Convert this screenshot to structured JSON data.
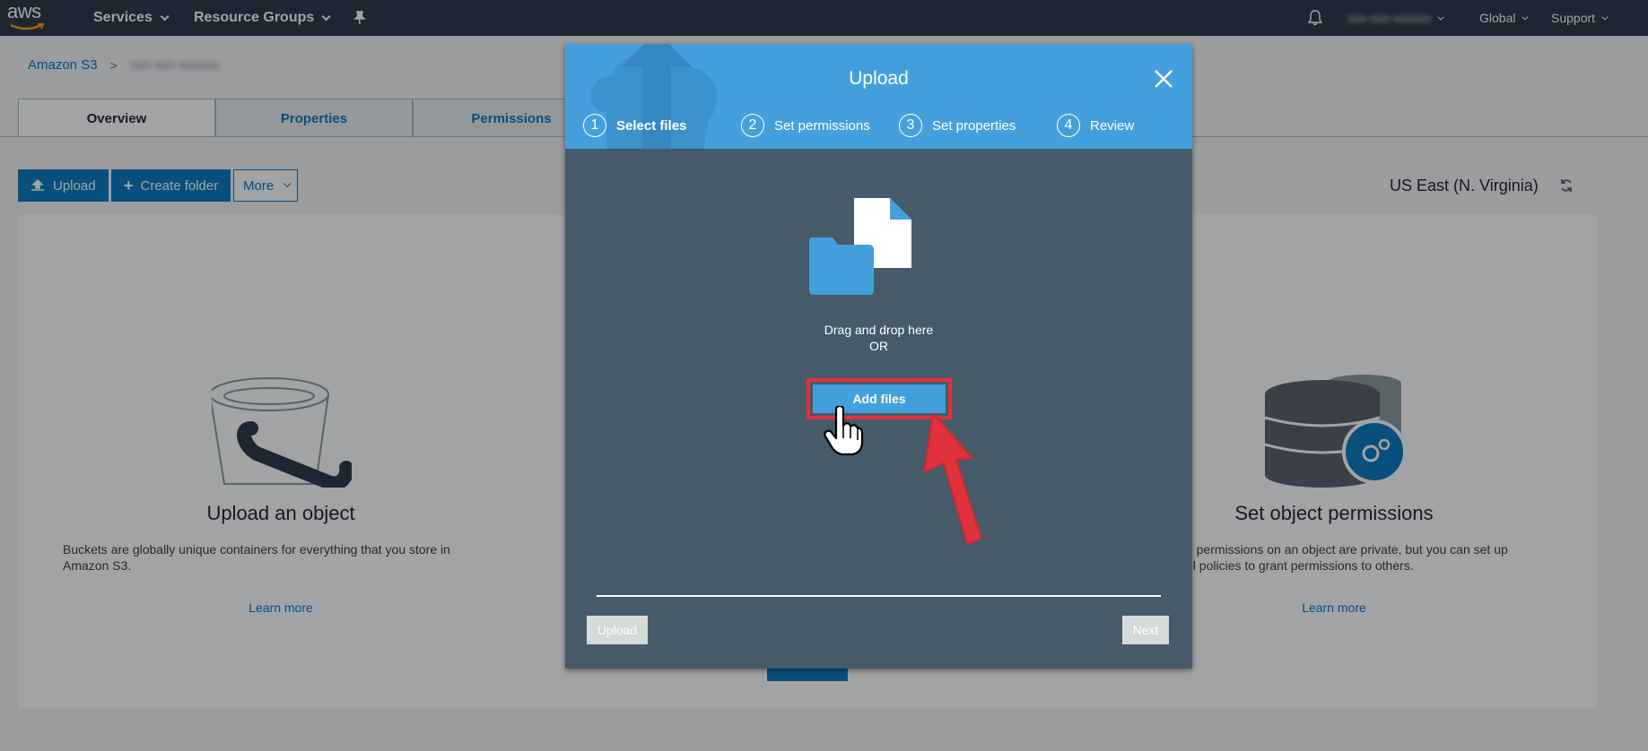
{
  "topnav": {
    "logo_text": "aws",
    "services": "Services",
    "resource_groups": "Resource Groups",
    "account": "xxx-xxx-xxxxxx",
    "region": "Global",
    "support": "Support"
  },
  "breadcrumb": {
    "root": "Amazon S3",
    "bucket": "xxx-xxx-xxxxxx"
  },
  "tabs": [
    "Overview",
    "Properties",
    "Permissions"
  ],
  "toolbar": {
    "upload": "Upload",
    "create_folder": "Create folder",
    "more": "More"
  },
  "region_label": "US East (N. Virginia)",
  "cards": {
    "left": {
      "title": "Upload an object",
      "desc_line1": "Buckets are globally unique containers for everything that you store in",
      "desc_line2": "Amazon S3.",
      "link": "Learn more"
    },
    "right": {
      "title": "Set object permissions",
      "desc_line1": "e permissions on an object are private, but you can set up",
      "desc_line2": "ol policies to grant permissions to others.",
      "link": "Learn more"
    }
  },
  "modal": {
    "title": "Upload",
    "steps": [
      {
        "num": "1",
        "label": "Select files"
      },
      {
        "num": "2",
        "label": "Set permissions"
      },
      {
        "num": "3",
        "label": "Set properties"
      },
      {
        "num": "4",
        "label": "Review"
      }
    ],
    "drag_text": "Drag and drop here",
    "or_text": "OR",
    "add_files": "Add files",
    "upload_btn": "Upload",
    "next_btn": "Next"
  },
  "colors": {
    "nav_bg": "#232f3e",
    "primary": "#0073bb",
    "modal_header": "#44a0dc",
    "modal_body": "#465a69",
    "highlight": "#e0323c"
  }
}
